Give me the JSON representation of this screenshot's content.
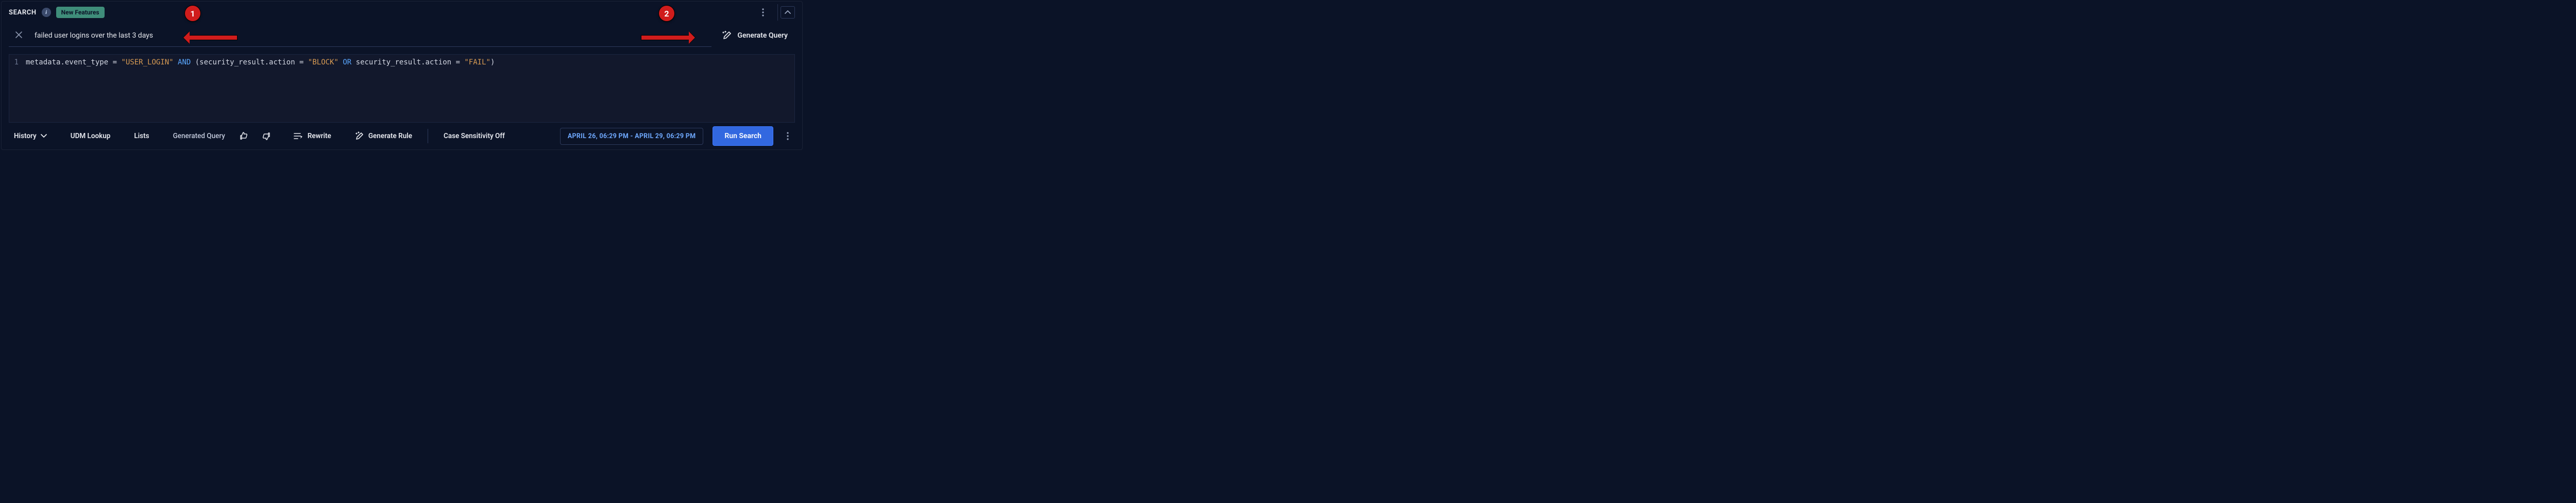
{
  "header": {
    "title": "SEARCH",
    "new_features_label": "New Features"
  },
  "nl_query": {
    "text": "failed user logins over the last 3 days",
    "generate_label": "Generate Query"
  },
  "code": {
    "line_number": "1",
    "tokens": [
      {
        "t": "metadata.event_type = ",
        "c": ""
      },
      {
        "t": "\"USER_LOGIN\"",
        "c": "str"
      },
      {
        "t": " ",
        "c": ""
      },
      {
        "t": "AND",
        "c": "kw"
      },
      {
        "t": " (security_result.action = ",
        "c": ""
      },
      {
        "t": "\"BLOCK\"",
        "c": "str"
      },
      {
        "t": " ",
        "c": ""
      },
      {
        "t": "OR",
        "c": "kw"
      },
      {
        "t": " security_result.action = ",
        "c": ""
      },
      {
        "t": "\"FAIL\"",
        "c": "str"
      },
      {
        "t": ")",
        "c": ""
      }
    ]
  },
  "toolbar": {
    "history": "History",
    "udm_lookup": "UDM Lookup",
    "lists": "Lists",
    "generated_query": "Generated Query",
    "rewrite": "Rewrite",
    "generate_rule": "Generate Rule",
    "case_sensitivity": "Case Sensitivity Off",
    "time_range": "APRIL 26, 06:29 PM - APRIL 29, 06:29 PM",
    "run": "Run Search"
  },
  "annotations": {
    "one": "1",
    "two": "2"
  }
}
